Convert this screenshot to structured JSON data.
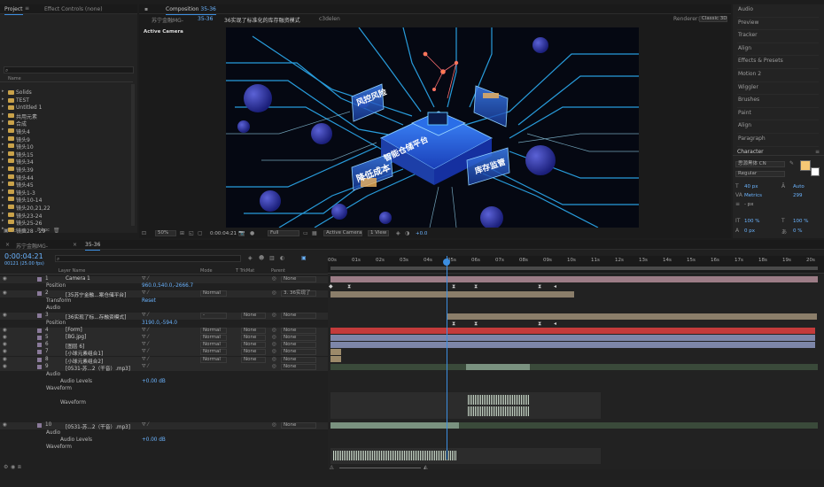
{
  "project_panel": {
    "tab_project": "Project",
    "tab_effect_controls": "Effect Controls (none)",
    "search_placeholder": "",
    "name_header": "Name",
    "items": [
      "Solids",
      "TEST",
      "Untitled 1",
      "共用元素",
      "合成",
      "镜头4",
      "镜头9",
      "镜头10",
      "镜头15",
      "镜头34",
      "镜头39",
      "镜头44",
      "镜头45",
      "镜头1-3",
      "镜头10-14",
      "镜头20,21,22",
      "镜头23-24",
      "镜头25-26",
      "镜头28 - 29"
    ],
    "bpc": "8 bpc"
  },
  "composition": {
    "panel_title_prefix": "Composition",
    "panel_title": "35-36",
    "crumbs": [
      "苏宁金融MG-",
      "35-36",
      "36实现了标准化的库存融资模式",
      "c3delen"
    ],
    "renderer_label": "Renderer:",
    "renderer_value": "Classic 3D",
    "active_camera": "Active Camera",
    "viewer_labels": {
      "platform": "智能仓储平台",
      "risk": "风控风险",
      "warehouse": "智能仓储",
      "cost": "降低成本",
      "monitor": "库存监管"
    },
    "footer": {
      "zoom": "50%",
      "time": "0:00:04:21",
      "res": "Full",
      "camera": "Active Camera",
      "view": "1 View",
      "exposure": "+0.0"
    }
  },
  "right_panel": {
    "items": [
      "Audio",
      "Preview",
      "Tracker",
      "Align",
      "Effects & Presets",
      "Motion 2",
      "Wiggler",
      "Brushes",
      "Paint",
      "Align",
      "Paragraph"
    ],
    "character_label": "Character",
    "font_name": "思源黑体 CN",
    "font_style": "Regular",
    "font_size": "40 px",
    "leading": "Auto",
    "tracking_label": "Metrics",
    "tracking_value": "299",
    "stroke": "- px",
    "vscale": "100 %",
    "hscale": "100 %",
    "baseline": "0 px",
    "tsume": "0 %",
    "fill_color": "#f7c875",
    "stroke_color": "#ffffff"
  },
  "timeline": {
    "tabs": [
      "苏宁金融MG-",
      "35-36"
    ],
    "timecode": "0:00:04:21",
    "frames": "00121 (25.00 fps)",
    "col_layer_name": "Layer Name",
    "col_mode": "Mode",
    "col_trkmat": "T TrkMat",
    "col_parent": "Parent",
    "ruler": [
      "00s",
      "01s",
      "02s",
      "03s",
      "04s",
      "05s",
      "06s",
      "07s",
      "08s",
      "09s",
      "10s",
      "11s",
      "12s",
      "13s",
      "14s",
      "15s",
      "16s",
      "17s",
      "18s",
      "19s",
      "20s"
    ],
    "layers": [
      {
        "num": "1",
        "name": "Camera 1",
        "mode": "",
        "parent": "None"
      },
      {
        "num": "",
        "name": "Position",
        "value": "960.0,540.0,-2666.7"
      },
      {
        "num": "2",
        "name": "[35苏宁金融...案仓储平台]",
        "mode": "Normal",
        "parent": "3. 36实现了"
      },
      {
        "num": "",
        "name": "Transform",
        "value": "Reset"
      },
      {
        "num": "",
        "name": "Audio",
        "value": ""
      },
      {
        "num": "3",
        "name": "[36实现了标...存融资模式]",
        "mode": "-",
        "trk": "None",
        "parent": "None"
      },
      {
        "num": "",
        "name": "Position",
        "value": "3190.0,-594.0"
      },
      {
        "num": "4",
        "name": "[Form]",
        "mode": "Normal",
        "trk": "None",
        "parent": "None"
      },
      {
        "num": "5",
        "name": "[BG.jpg]",
        "mode": "Normal",
        "trk": "None",
        "parent": "None"
      },
      {
        "num": "6",
        "name": "[图层 6]",
        "mode": "Normal",
        "trk": "None",
        "parent": "None"
      },
      {
        "num": "7",
        "name": "[小球元素组合1]",
        "mode": "Normal",
        "trk": "None",
        "parent": "None"
      },
      {
        "num": "8",
        "name": "[小球元素组合2]",
        "mode": "Normal",
        "trk": "None",
        "parent": "None"
      },
      {
        "num": "9",
        "name": "[0531-苏...2（干音）.mp3]",
        "mode": "",
        "trk": "",
        "parent": "None"
      },
      {
        "num": "",
        "name": "Audio",
        "value": ""
      },
      {
        "num": "",
        "name": "Audio Levels",
        "value": "+0.00 dB"
      },
      {
        "num": "",
        "name": "Waveform",
        "value": ""
      },
      {
        "num": "",
        "name": "Waveform",
        "value": ""
      },
      {
        "num": "10",
        "name": "[0531-苏...2（干音）.mp3]",
        "mode": "",
        "trk": "",
        "parent": "None"
      },
      {
        "num": "",
        "name": "Audio",
        "value": ""
      },
      {
        "num": "",
        "name": "Audio Levels",
        "value": "+0.00 dB"
      },
      {
        "num": "",
        "name": "Waveform",
        "value": ""
      }
    ]
  }
}
